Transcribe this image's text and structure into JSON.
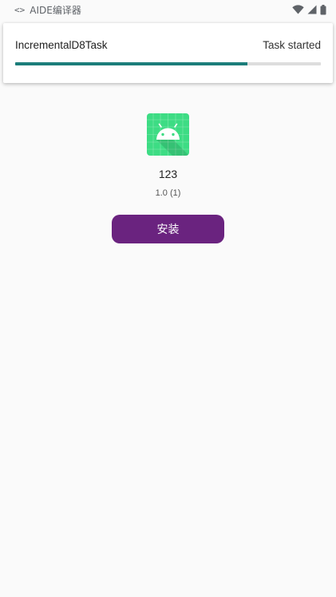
{
  "status_bar": {
    "code_icon": "<>",
    "app_name": "AIDE编译器",
    "icons": [
      "wifi-icon",
      "signal-icon",
      "battery-icon"
    ]
  },
  "task": {
    "name": "IncrementalD8Task",
    "status": "Task started",
    "progress_fraction": 0.76
  },
  "app": {
    "icon": "android-robot-icon",
    "title": "123",
    "version": "1.0 (1)",
    "install_label": "安装"
  },
  "colors": {
    "progress": "#1B7D7A",
    "progress_track": "#DDDDDD",
    "install_button": "#6A237F",
    "app_icon_bg": "#3DDC84",
    "background": "#FAFAFA"
  }
}
